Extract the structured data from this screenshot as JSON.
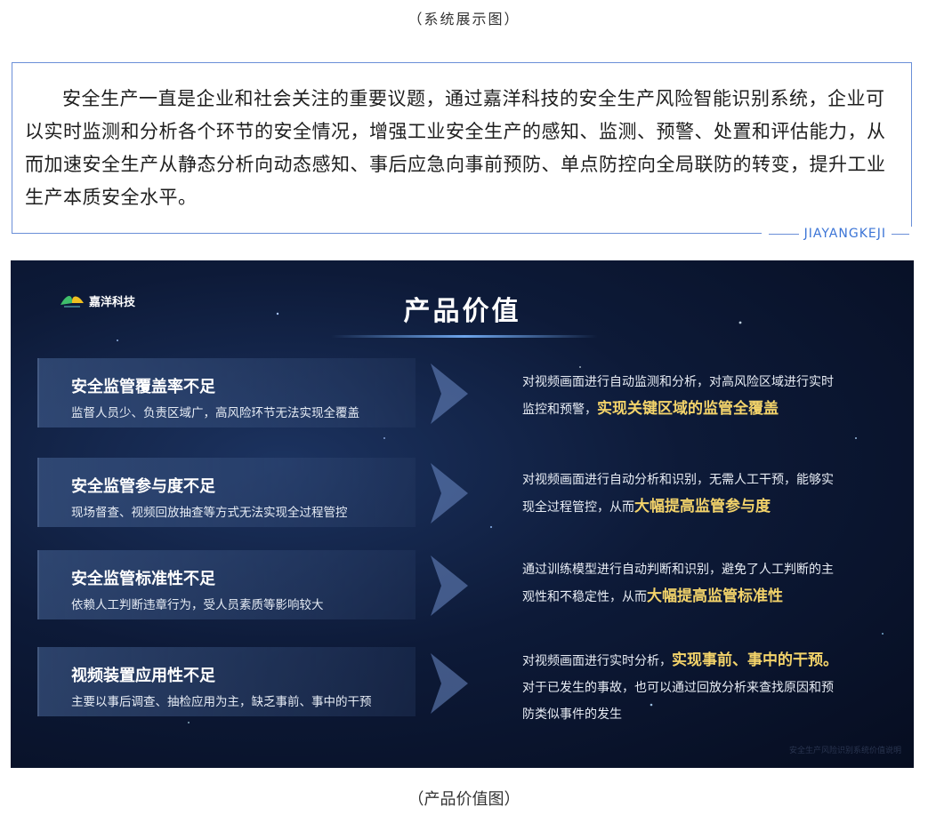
{
  "captions": {
    "top": "（系统展示图）",
    "bottom": "（产品价值图）"
  },
  "intro": {
    "text": "安全生产一直是企业和社会关注的重要议题，通过嘉洋科技的安全生产风险智能识别系统，企业可以实时监测和分析各个环节的安全情况，增强工业安全生产的感知、监测、预警、处置和评估能力，从而加速安全生产从静态分析向动态感知、事后应急向事前预防、单点防控向全局联防的转变，提升工业生产本质安全水平。",
    "brand": "JIAYANGKEJI"
  },
  "slide": {
    "logo": "嘉洋科技",
    "title": "产品价值",
    "watermark": "安全生产风险识别系统价值说明",
    "rows": [
      {
        "problem": "安全监管覆盖率不足",
        "desc": "监督人员少、负责区域广，高风险环节无法实现全覆盖",
        "value_lines": [
          {
            "pre": "对视频画面进行自动监测和分析，对高风险区域进行实时",
            "hl": ""
          },
          {
            "pre": "监控和预警，",
            "hl": "实现关键区域的监管全覆盖"
          }
        ]
      },
      {
        "problem": "安全监管参与度不足",
        "desc": "现场督查、视频回放抽查等方式无法实现全过程管控",
        "value_lines": [
          {
            "pre": "对视频画面进行自动分析和识别，无需人工干预，能够实",
            "hl": ""
          },
          {
            "pre": "现全过程管控，从而",
            "hl": "大幅提高监管参与度"
          }
        ]
      },
      {
        "problem": "安全监管标准性不足",
        "desc": "依赖人工判断违章行为，受人员素质等影响较大",
        "value_lines": [
          {
            "pre": "通过训练模型进行自动判断和识别，避免了人工判断的主",
            "hl": ""
          },
          {
            "pre": "观性和不稳定性，从而",
            "hl": "大幅提高监管标准性"
          }
        ]
      },
      {
        "problem": "视频装置应用性不足",
        "desc": "主要以事后调查、抽检应用为主，缺乏事前、事中的干预",
        "value_lines": [
          {
            "pre": "对视频画面进行实时分析，",
            "hl": "实现事前、事中的干预。"
          },
          {
            "pre": "对于已发生的事故，也可以通过回放分析来查找原因和预",
            "hl": ""
          },
          {
            "pre": "防类似事件的发生",
            "hl": ""
          }
        ]
      }
    ]
  }
}
